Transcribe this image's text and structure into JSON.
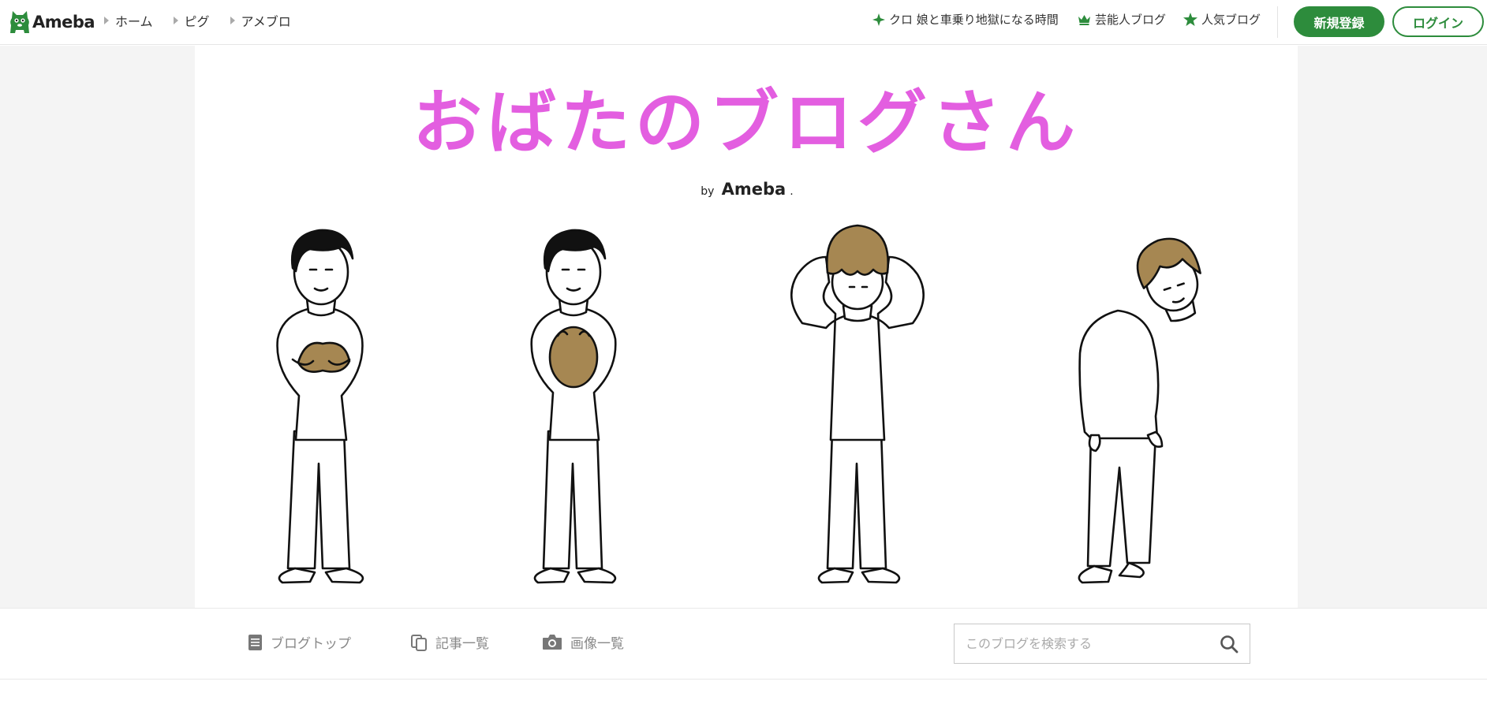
{
  "header": {
    "brand": "Ameba",
    "breadcrumbs": [
      {
        "label": "ホーム"
      },
      {
        "label": "ピグ"
      },
      {
        "label": "アメブロ"
      }
    ],
    "quick_links": [
      {
        "icon": "sparkle-icon",
        "label": "クロ 娘と車乗り地獄になる時間"
      },
      {
        "icon": "crown-icon",
        "label": "芸能人ブログ"
      },
      {
        "icon": "star-icon",
        "label": "人気ブログ"
      }
    ],
    "signup_label": "新規登録",
    "login_label": "ログイン"
  },
  "banner": {
    "title": "おばたのブログさん",
    "byline_prefix": "by",
    "byline_brand": "Ameba",
    "byline_dot": "."
  },
  "blog_nav": {
    "items": [
      {
        "icon": "document-icon",
        "label": "ブログトップ"
      },
      {
        "icon": "copy-icon",
        "label": "記事一覧"
      },
      {
        "icon": "camera-icon",
        "label": "画像一覧"
      }
    ],
    "search_placeholder": "このブログを検索する"
  },
  "colors": {
    "brand_green": "#2d8c3c",
    "title_pink": "#e35ee0",
    "hair_brown": "#a68752"
  }
}
